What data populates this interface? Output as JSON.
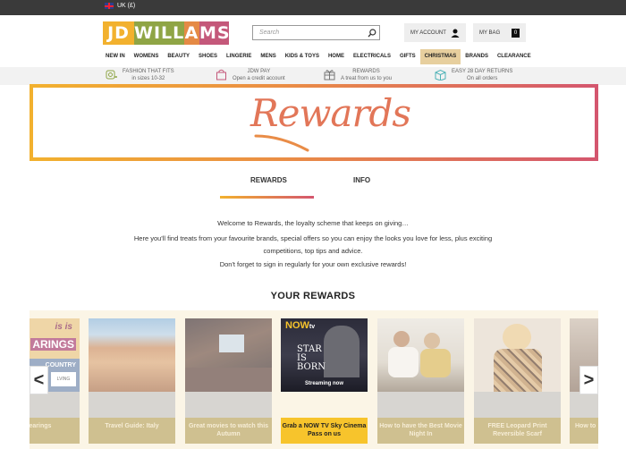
{
  "topbar": {
    "locale": "UK (£)"
  },
  "header": {
    "logo": [
      "JD",
      "WILLI",
      "A",
      "MS"
    ],
    "search_placeholder": "Search",
    "account_label": "MY ACCOUNT",
    "bag_label": "MY BAG",
    "bag_count": "0"
  },
  "nav": [
    "NEW IN",
    "WOMENS",
    "BEAUTY",
    "SHOES",
    "LINGERIE",
    "MENS",
    "KIDS & TOYS",
    "HOME",
    "ELECTRICALS",
    "GIFTS",
    "CHRISTMAS",
    "BRANDS",
    "CLEARANCE"
  ],
  "usp": [
    {
      "title": "FASHION THAT FITS",
      "sub": "in sizes 10-32",
      "icon": "tape-measure-icon"
    },
    {
      "title": "JDW PAY",
      "sub": "Open a credit account",
      "icon": "shopping-bag-icon"
    },
    {
      "title": "REWARDS",
      "sub": "A treat from us to you",
      "icon": "gift-icon"
    },
    {
      "title": "EASY 28 DAY RETURNS",
      "sub": "On all orders",
      "icon": "return-box-icon"
    }
  ],
  "banner": {
    "title": "Rewards"
  },
  "tabs": {
    "rewards": "REWARDS",
    "info": "INFO"
  },
  "intro": [
    "Welcome to Rewards, the loyalty scheme that keeps on giving…",
    "Here you'll find treats from your favourite brands, special offers so you can enjoy the looks you love for less, plus exciting",
    "competitions, top tips and advice.",
    "Don't forget to sign in regularly for your own exclusive rewards!"
  ],
  "section_title": "YOUR REWARDS",
  "rewards": [
    {
      "caption": "Shearings",
      "img_text": [
        "is is",
        "ARINGS",
        "COUNTRY",
        "LVING"
      ]
    },
    {
      "caption": "Travel Guide: Italy"
    },
    {
      "caption": "Great movies to watch this Autumn"
    },
    {
      "caption": "Grab a NOW TV Sky Cinema Pass on us",
      "img_text": [
        "NOW",
        "tv",
        "STAR",
        "IS",
        "BORN",
        "Streaming now"
      ]
    },
    {
      "caption": "How to have the Best Movie Night In"
    },
    {
      "caption": "FREE Leopard Print Reversible Scarf"
    },
    {
      "caption": "How to"
    }
  ],
  "arrows": {
    "prev": "<",
    "next": ">"
  },
  "colors": {
    "accent_yellow": "#f7c42c",
    "gradient_start": "#f2b12e",
    "gradient_end": "#d4566e",
    "nav_highlight": "#e7cf9e"
  }
}
